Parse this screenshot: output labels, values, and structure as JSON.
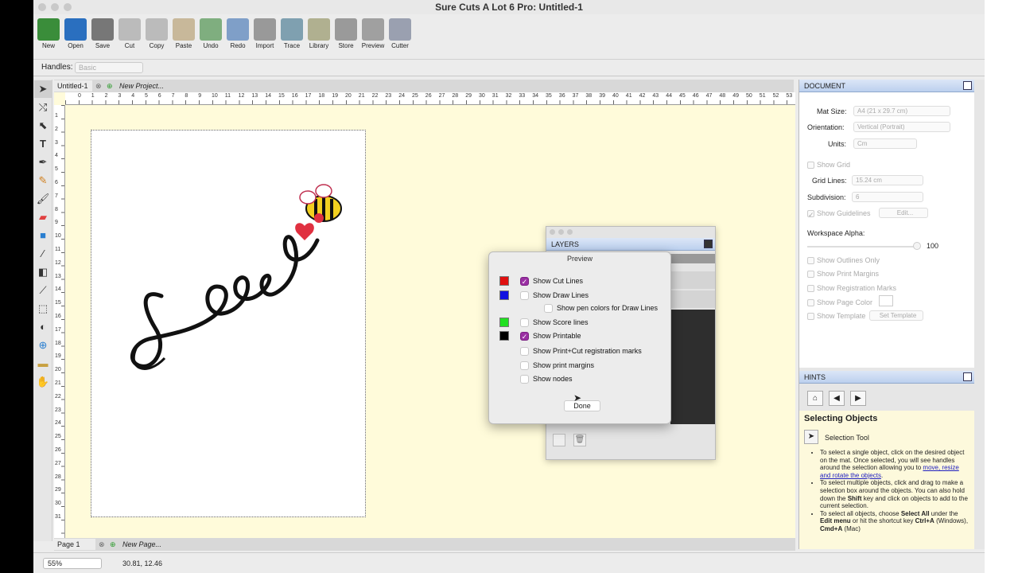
{
  "window": {
    "title": "Sure Cuts A Lot 6 Pro: Untitled-1"
  },
  "toolbar": {
    "buttons": [
      {
        "label": "New",
        "icon": "new-icon",
        "color": "#3a8d3a"
      },
      {
        "label": "Open",
        "icon": "open-icon",
        "color": "#2a6fbf"
      },
      {
        "label": "Save",
        "icon": "save-icon",
        "color": "#777777"
      },
      {
        "label": "Cut",
        "icon": "cut-icon",
        "color": "#bbbbbb"
      },
      {
        "label": "Copy",
        "icon": "copy-icon",
        "color": "#bbbbbb"
      },
      {
        "label": "Paste",
        "icon": "paste-icon",
        "color": "#c8b89a"
      },
      {
        "label": "Undo",
        "icon": "undo-icon",
        "color": "#7fae7f"
      },
      {
        "label": "Redo",
        "icon": "redo-icon",
        "color": "#7f9fc8"
      },
      {
        "label": "Import",
        "icon": "import-svg-icon",
        "color": "#999999"
      },
      {
        "label": "Trace",
        "icon": "trace-icon",
        "color": "#7fa0b0"
      },
      {
        "label": "Library",
        "icon": "library-icon",
        "color": "#b0b090"
      },
      {
        "label": "Store",
        "icon": "store-icon",
        "color": "#9a9a9a"
      },
      {
        "label": "Preview",
        "icon": "preview-icon",
        "color": "#a0a0a0"
      },
      {
        "label": "Cutter",
        "icon": "cutter-icon",
        "color": "#9aa0b0"
      }
    ]
  },
  "handles": {
    "label": "Handles:",
    "value": "Basic"
  },
  "tabs": {
    "doc_tab": "Untitled-1",
    "new_project": "New Project..."
  },
  "ruler": {
    "h_labels": [
      "0",
      "1",
      "2",
      "3",
      "4",
      "5",
      "6",
      "7",
      "8",
      "9",
      "10",
      "11",
      "12",
      "13",
      "14",
      "15",
      "16",
      "17",
      "18",
      "19",
      "20",
      "21",
      "22",
      "23",
      "24",
      "25",
      "26",
      "27",
      "28",
      "29",
      "30",
      "31",
      "32",
      "33",
      "34",
      "35",
      "36",
      "37",
      "38",
      "39",
      "40",
      "41",
      "42",
      "43",
      "44",
      "45",
      "46",
      "47",
      "48",
      "49",
      "50",
      "51",
      "52",
      "53"
    ],
    "v_labels": [
      "1",
      "2",
      "3",
      "4",
      "5",
      "6",
      "7",
      "8",
      "9",
      "10",
      "11",
      "12",
      "13",
      "14",
      "15",
      "16",
      "17",
      "18",
      "19",
      "20",
      "21",
      "22",
      "23",
      "24",
      "25",
      "26",
      "27",
      "28",
      "29",
      "30",
      "31"
    ]
  },
  "pages": {
    "page1": "Page 1",
    "new_page": "New Page..."
  },
  "status": {
    "zoom": "55%",
    "coords": "30.81, 12.46"
  },
  "document": {
    "header": "DOCUMENT",
    "mat_size_label": "Mat Size:",
    "mat_size": "A4 (21 x 29.7 cm)",
    "orientation_label": "Orientation:",
    "orientation": "Vertical (Portrait)",
    "units_label": "Units:",
    "units": "Cm",
    "show_grid": "Show Grid",
    "grid_lines_label": "Grid Lines:",
    "grid_lines": "15.24 cm",
    "subdivision_label": "Subdivision:",
    "subdivision": "6",
    "show_guidelines": "Show Guidelines",
    "edit": "Edit...",
    "workspace_alpha_label": "Workspace Alpha:",
    "workspace_alpha": "100",
    "show_outlines_only": "Show Outlines Only",
    "show_print_margins": "Show Print Margins",
    "show_registration_marks": "Show Registration Marks",
    "show_page_color": "Show Page Color",
    "show_template": "Show Template",
    "set_template": "Set Template"
  },
  "hints": {
    "header": "HINTS",
    "title": "Selecting Objects",
    "tool": "Selection Tool",
    "b1_pre": "To select a single object, click on the desired object on the mat. Once selected, you will see handles around the selection allowing you to ",
    "b1_link": "move, resize and rotate the objects",
    "b1_post": ".",
    "b2": "To select multiple objects, click and drag to make a selection box around the objects. You can also hold down the ",
    "b2_key": "Shift",
    "b2_post": " key and click on objects to add to the current selection.",
    "b3_pre": "To select all objects, choose ",
    "b3_k1": "Select All",
    "b3_mid": " under the ",
    "b3_k2": "Edit menu",
    "b3_mid2": " or hit the shortcut key ",
    "b3_k3": "Ctrl+A",
    "b3_mid3": " (Windows), ",
    "b3_k4": "Cmd+A",
    "b3_post": " (Mac)"
  },
  "layers": {
    "header": "LAYERS"
  },
  "preview": {
    "title": "Preview",
    "rows": [
      {
        "label": "Show Cut Lines",
        "checked": true,
        "swatch": "#e01010"
      },
      {
        "label": "Show Draw Lines",
        "checked": false,
        "swatch": "#1010e0"
      },
      {
        "label": "Show pen colors for Draw Lines",
        "checked": false,
        "swatch": ""
      },
      {
        "label": "Show Score lines",
        "checked": false,
        "swatch": "#20e020"
      },
      {
        "label": "Show Printable",
        "checked": true,
        "swatch": "#000000"
      },
      {
        "label": "Show Print+Cut registration marks",
        "checked": false,
        "swatch": ""
      },
      {
        "label": "Show print margins",
        "checked": false,
        "swatch": ""
      },
      {
        "label": "Show nodes",
        "checked": false,
        "swatch": ""
      }
    ],
    "done": "Done"
  },
  "artwork": {
    "description_text": "Love"
  }
}
